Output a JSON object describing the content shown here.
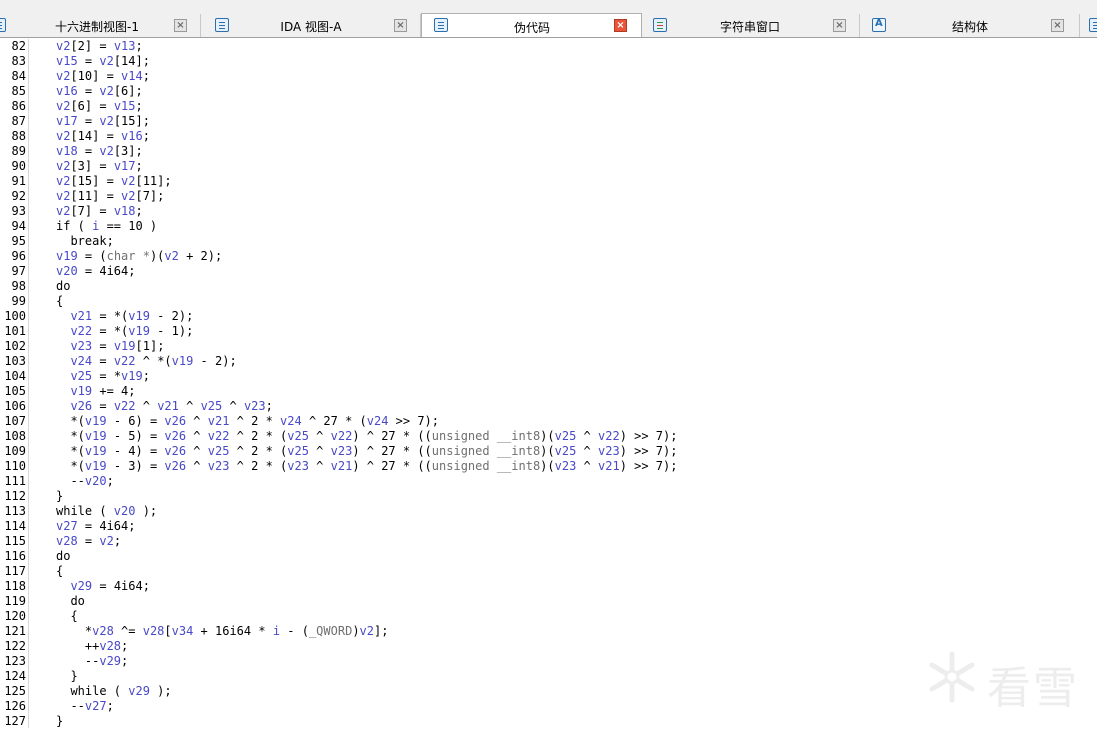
{
  "tabs": [
    {
      "label": "十六进制视图-1",
      "icon": "hex-view-icon",
      "active": false
    },
    {
      "label": "IDA 视图-A",
      "icon": "disassembly-view-icon",
      "active": false
    },
    {
      "label": "伪代码",
      "icon": "pseudocode-icon",
      "active": true
    },
    {
      "label": "字符串窗口",
      "icon": "strings-window-icon",
      "active": false
    },
    {
      "label": "结构体",
      "icon": "structures-icon",
      "active": false
    }
  ],
  "code": {
    "first_line_number": 82,
    "lines": [
      "  v2[2] = v13;",
      "  v15 = v2[14];",
      "  v2[10] = v14;",
      "  v16 = v2[6];",
      "  v2[6] = v15;",
      "  v17 = v2[15];",
      "  v2[14] = v16;",
      "  v18 = v2[3];",
      "  v2[3] = v17;",
      "  v2[15] = v2[11];",
      "  v2[11] = v2[7];",
      "  v2[7] = v18;",
      "  if ( i == 10 )",
      "    break;",
      "  v19 = (char *)(v2 + 2);",
      "  v20 = 4i64;",
      "  do",
      "  {",
      "    v21 = *(v19 - 2);",
      "    v22 = *(v19 - 1);",
      "    v23 = v19[1];",
      "    v24 = v22 ^ *(v19 - 2);",
      "    v25 = *v19;",
      "    v19 += 4;",
      "    v26 = v22 ^ v21 ^ v25 ^ v23;",
      "    *(v19 - 6) = v26 ^ v21 ^ 2 * v24 ^ 27 * (v24 >> 7);",
      "    *(v19 - 5) = v26 ^ v22 ^ 2 * (v25 ^ v22) ^ 27 * ((unsigned __int8)(v25 ^ v22) >> 7);",
      "    *(v19 - 4) = v26 ^ v25 ^ 2 * (v25 ^ v23) ^ 27 * ((unsigned __int8)(v25 ^ v23) >> 7);",
      "    *(v19 - 3) = v26 ^ v23 ^ 2 * (v23 ^ v21) ^ 27 * ((unsigned __int8)(v23 ^ v21) >> 7);",
      "    --v20;",
      "  }",
      "  while ( v20 );",
      "  v27 = 4i64;",
      "  v28 = v2;",
      "  do",
      "  {",
      "    v29 = 4i64;",
      "    do",
      "    {",
      "      *v28 ^= v28[v34 + 16i64 * i - (_QWORD)v2];",
      "      ++v28;",
      "      --v29;",
      "    }",
      "    while ( v29 );",
      "    --v27;",
      "  }"
    ]
  },
  "watermark": {
    "text": "看雪",
    "icon": "snowflake-logo-icon"
  },
  "colors": {
    "variable": "#4848c8",
    "cast": "#707070",
    "active_close": "#e8553b"
  }
}
